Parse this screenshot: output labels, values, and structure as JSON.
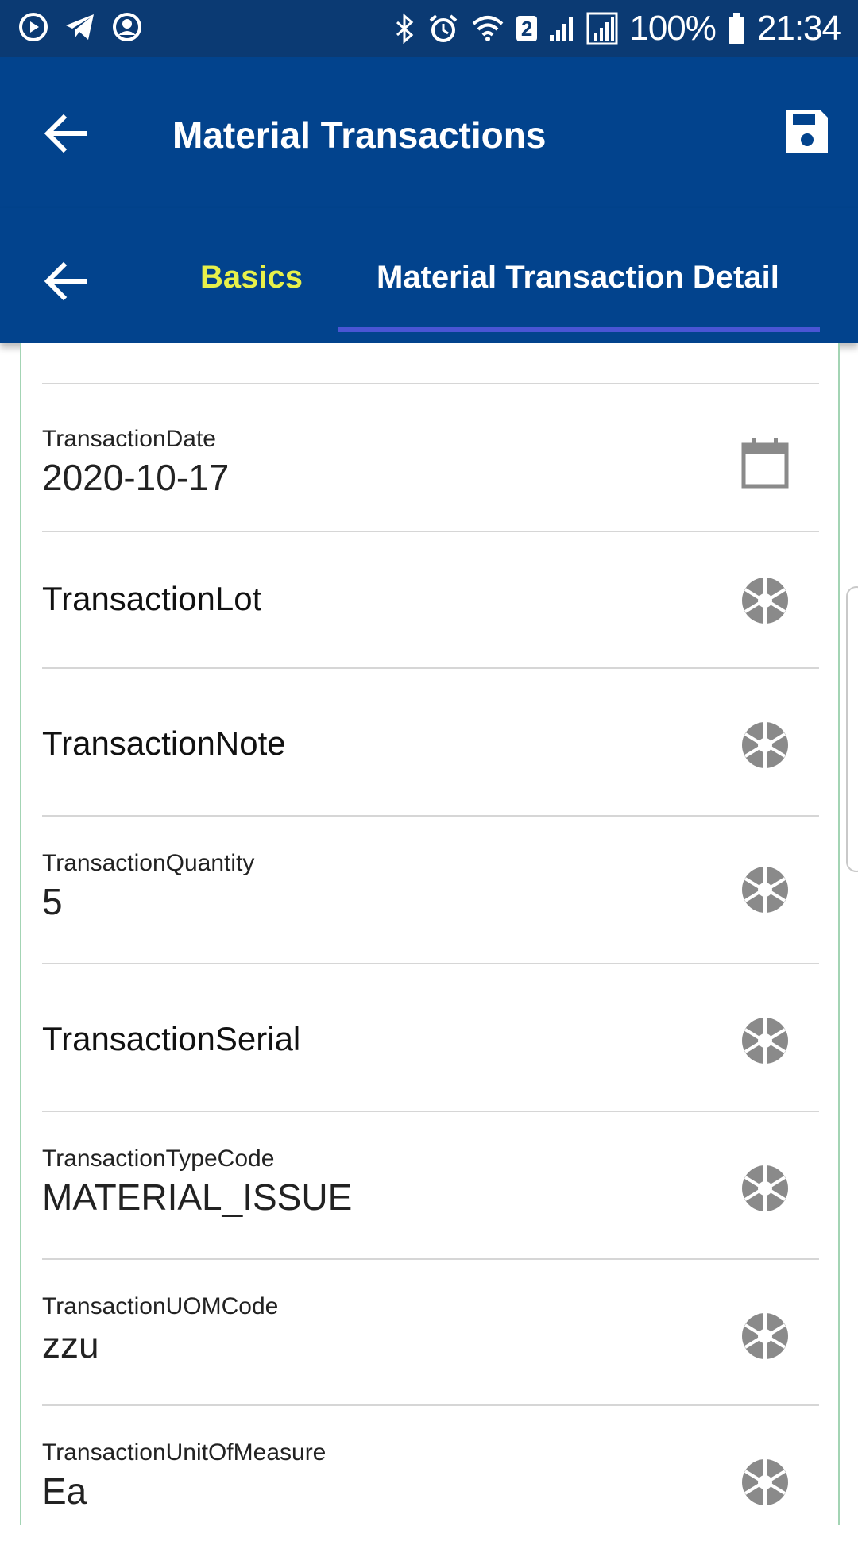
{
  "status_bar": {
    "battery_percent": "100%",
    "time": "21:34",
    "sim_badge": "2",
    "left_icons": [
      "play-circle-icon",
      "telegram-icon",
      "account-circle-icon"
    ],
    "right_icons": [
      "bluetooth-icon",
      "alarm-icon",
      "wifi-icon",
      "signal-icon",
      "signal-roaming-icon",
      "battery-icon"
    ]
  },
  "app_bar": {
    "title": "Material Transactions",
    "back_icon": "arrow-left-icon",
    "save_icon": "save-icon"
  },
  "tabs": {
    "back_icon": "arrow-left-icon",
    "items": [
      {
        "label": "Basics",
        "active": false
      },
      {
        "label": "Material Transaction Detail",
        "active": true
      }
    ],
    "colors": {
      "basics": "#e7f04a",
      "active": "#ffffff",
      "indicator": "#4a55d4"
    }
  },
  "fields": [
    {
      "label": "TransactionDate",
      "value": "2020-10-17",
      "icon": "calendar-icon"
    },
    {
      "label": "TransactionLot",
      "value": "",
      "icon": "camera-aperture-icon"
    },
    {
      "label": "TransactionNote",
      "value": "",
      "icon": "camera-aperture-icon"
    },
    {
      "label": "TransactionQuantity",
      "value": "5",
      "icon": "camera-aperture-icon"
    },
    {
      "label": "TransactionSerial",
      "value": "",
      "icon": "camera-aperture-icon"
    },
    {
      "label": "TransactionTypeCode",
      "value": "MATERIAL_ISSUE",
      "icon": "camera-aperture-icon"
    },
    {
      "label": "TransactionUOMCode",
      "value": "zzu",
      "icon": "camera-aperture-icon"
    },
    {
      "label": "TransactionUnitOfMeasure",
      "value": "Ea",
      "icon": "camera-aperture-icon"
    }
  ],
  "colors": {
    "status_bar": "#0b3a73",
    "app_bar": "#02438d",
    "content_border": "#a3d4b4",
    "icon_gray": "#8a8a8a"
  }
}
